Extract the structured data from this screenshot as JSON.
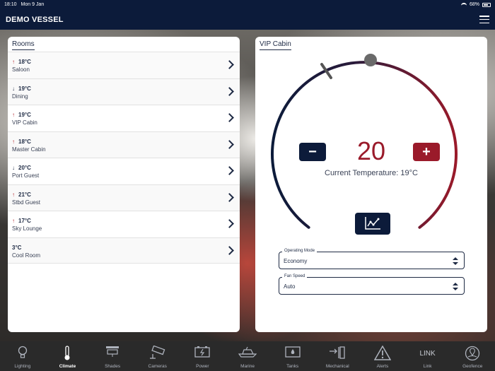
{
  "status_bar": {
    "time": "18:10",
    "date": "Mon 9 Jan",
    "battery": "68%"
  },
  "header": {
    "title": "DEMO VESSEL"
  },
  "rooms_panel": {
    "title": "Rooms",
    "rooms": [
      {
        "trend": "up",
        "temp": "18°C",
        "name": "Saloon"
      },
      {
        "trend": "down",
        "temp": "19°C",
        "name": "Dining"
      },
      {
        "trend": "up",
        "temp": "19°C",
        "name": "VIP Cabin"
      },
      {
        "trend": "up",
        "temp": "18°C",
        "name": "Master Cabin"
      },
      {
        "trend": "down",
        "temp": "20°C",
        "name": "Port Guest"
      },
      {
        "trend": "up",
        "temp": "21°C",
        "name": "Stbd Guest"
      },
      {
        "trend": "up",
        "temp": "17°C",
        "name": "Sky Lounge"
      },
      {
        "trend": "none",
        "temp": "3°C",
        "name": "Cool Room"
      }
    ]
  },
  "vip_panel": {
    "title": "VIP Cabin",
    "setpoint": "20",
    "current_temperature": "Current Temperature: 19°C",
    "minus_label": "−",
    "plus_label": "+",
    "operating_mode": {
      "label": "Operating Mode",
      "value": "Economy"
    },
    "fan_speed": {
      "label": "Fan Speed",
      "value": "Auto"
    },
    "colors": {
      "cool": "#0c1b3a",
      "warm": "#9a1a2a"
    }
  },
  "tabs": [
    {
      "label": "Lighting",
      "icon": "bulb-icon"
    },
    {
      "label": "Climate",
      "icon": "thermometer-icon",
      "active": true
    },
    {
      "label": "Shades",
      "icon": "shades-icon"
    },
    {
      "label": "Cameras",
      "icon": "camera-icon"
    },
    {
      "label": "Power",
      "icon": "battery-icon"
    },
    {
      "label": "Marine",
      "icon": "boat-icon"
    },
    {
      "label": "Tanks",
      "icon": "tank-icon"
    },
    {
      "label": "Mechanical",
      "icon": "mechanical-icon"
    },
    {
      "label": "Alerts",
      "icon": "alert-icon"
    },
    {
      "label": "Link",
      "icon": "link-text-icon",
      "text": "LINK"
    },
    {
      "label": "Geofence",
      "icon": "geofence-icon"
    }
  ]
}
